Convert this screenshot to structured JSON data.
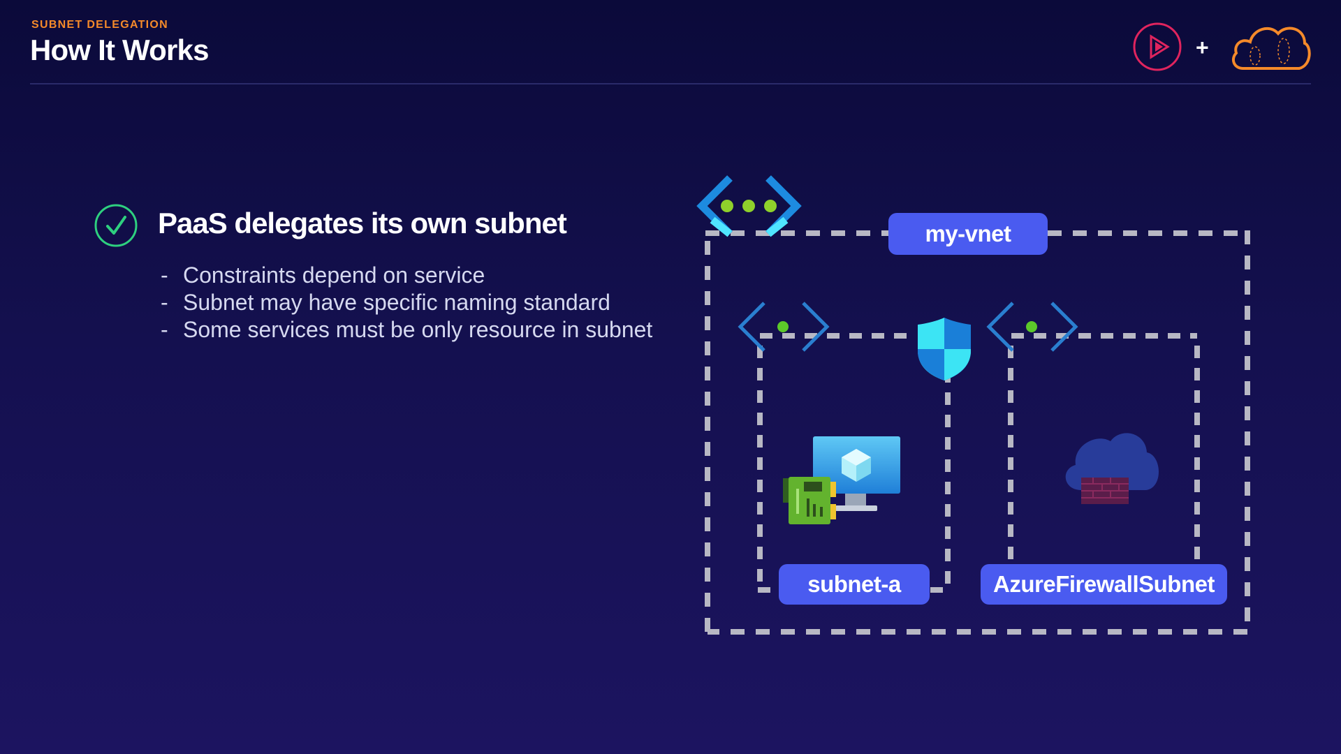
{
  "header": {
    "kicker": "SUBNET DELEGATION",
    "title": "How It Works"
  },
  "logos": {
    "left": "play-logo-icon",
    "plus": "+",
    "right": "cloud-logo-icon"
  },
  "content": {
    "heading": "PaaS delegates its own subnet",
    "bullets": [
      "Constraints depend on service",
      "Subnet may have specific naming standard",
      "Some services must be only resource in subnet"
    ]
  },
  "diagram": {
    "vnet_label": "my-vnet",
    "subnet_a_label": "subnet-a",
    "firewall_subnet_label": "AzureFirewallSubnet",
    "icons": [
      "vnet-icon",
      "subnet-icon",
      "shield-icon",
      "virtual-machine-icon",
      "network-interface-icon",
      "firewall-icon"
    ]
  },
  "colors": {
    "accent_orange": "#f58a2a",
    "pill_blue": "#4a5bf0",
    "check_green": "#2ed07f",
    "dash_gray": "#b8b8c4"
  }
}
